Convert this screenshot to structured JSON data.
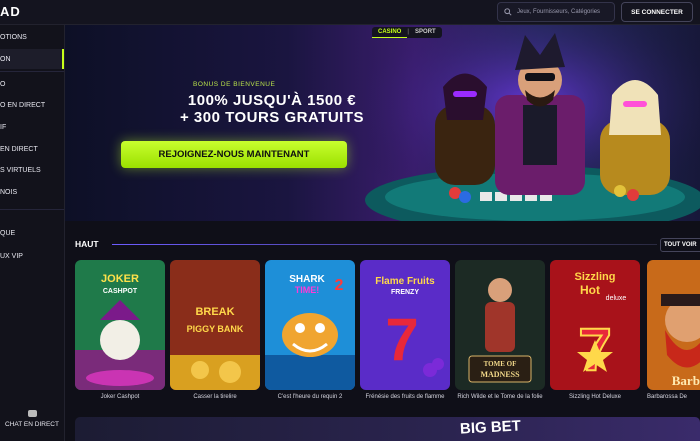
{
  "header": {
    "logo": "AD",
    "search_placeholder": "Jeux, Fournisseurs, Catégories",
    "login_label": "SE CONNECTER"
  },
  "sidebar": {
    "items": [
      {
        "label": "OTIONS"
      },
      {
        "label": "ON"
      },
      {
        "label": "O"
      },
      {
        "label": "O EN DIRECT"
      },
      {
        "label": "IF"
      },
      {
        "label": "EN DIRECT"
      },
      {
        "label": "S VIRTUELS"
      },
      {
        "label": "NOIS"
      },
      {
        "label": "QUE"
      },
      {
        "label": "UX VIP"
      }
    ],
    "chat_label": "CHAT EN DIRECT"
  },
  "banner": {
    "tabs": [
      "CASINO",
      "SPORT"
    ],
    "active_tab": "CASINO",
    "kicker": "BONUS DE BIENVENUE",
    "headline_line1": "100% JUSQU'À 1500 €",
    "headline_line2": "+ 300 TOURS GRATUITS",
    "cta_label": "REJOIGNEZ-NOUS MAINTENANT"
  },
  "section": {
    "title": "HAUT",
    "see_all_label": "TOUT VOIR"
  },
  "games": [
    {
      "name": "Joker Cashpot",
      "art": "JOKER CASHPOT"
    },
    {
      "name": "Casser la tirelire",
      "art": "BREAK THE PIGGY BANK"
    },
    {
      "name": "C'est l'heure du requin 2",
      "art": "SHARK TIME! 2"
    },
    {
      "name": "Frénésie des fruits de flamme",
      "art": "Flame Fruits FRENZY"
    },
    {
      "name": "Rich Wilde et le Tome de la folie",
      "art": "TOME OF MADNESS"
    },
    {
      "name": "Sizzling Hot Deluxe",
      "art": "Sizzling Hot deluxe"
    },
    {
      "name": "Barbarossa De",
      "art": "Barbar"
    }
  ],
  "promo": {
    "label": "BIG BET"
  },
  "colors": {
    "accent": "#c6ff1a",
    "background": "#0f0f18",
    "sidebar": "#12121b"
  }
}
